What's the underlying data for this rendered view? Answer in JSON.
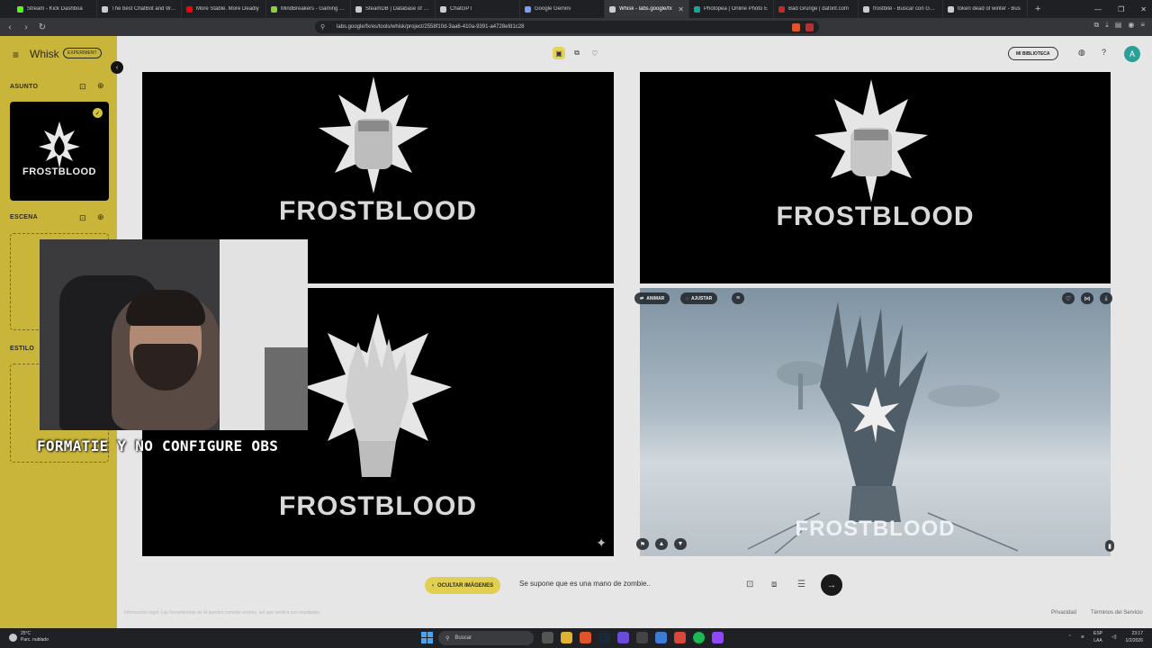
{
  "browser": {
    "tabs": [
      {
        "label": "Stream - Kick Dashboa",
        "color": "#53fc18",
        "active": false
      },
      {
        "label": "The best ChatBot and Widg",
        "color": "#cccccc",
        "active": false
      },
      {
        "label": "More Stable. More Deadly",
        "color": "#ff0000",
        "active": false
      },
      {
        "label": "MindBreakers - Gaming Co",
        "color": "#8ccf3a",
        "active": false
      },
      {
        "label": "SteamDB | Database of eve",
        "color": "#cccccc",
        "active": false
      },
      {
        "label": "ChatGPT",
        "color": "#cccccc",
        "active": false
      },
      {
        "label": "Google Gemini",
        "color": "#7b9cff",
        "active": false
      },
      {
        "label": "Whisk - labs.google/fx",
        "color": "#cccccc",
        "active": true
      },
      {
        "label": "Photopea | Online Photo E",
        "color": "#18a497",
        "active": false
      },
      {
        "label": "Bad Grunge | dafont.com",
        "color": "#c62828",
        "active": false
      },
      {
        "label": "frostbite - Buscar con Goog",
        "color": "#cccccc",
        "active": false
      },
      {
        "label": "token dead of winter - Bus",
        "color": "#cccccc",
        "active": false
      }
    ],
    "url": "labs.google/fx/es/tools/whisk/project/2558f10d-3aa6-410a-9391-a4728efd1c28"
  },
  "app": {
    "brand": "Whisk",
    "experiment_badge": "EXPERIMENT",
    "sections": {
      "subject": "ASUNTO",
      "scene": "ESCENA",
      "style": "ESTILO"
    },
    "subject_card_text": "FROSTBLOOD",
    "library_button": "MI BIBLIOTECA",
    "avatar_letter": "A",
    "images": [
      {
        "logo": "FROSTBLOOD"
      },
      {
        "logo": "FROSTBLOOD"
      },
      {
        "logo": "FROSTBLOOD"
      },
      {
        "logo": "FROSTBLOOD"
      }
    ],
    "image_actions": {
      "animate": "ANIMAR",
      "adjust": "AJUSTAR"
    },
    "hide_images_button": "OCULTAR IMÁGENES",
    "prompt_text": "Se supone que es una mano de zombie..",
    "footer_left": "Información legal: Las herramientas de IA pueden cometer errores, así que verifica sus resultados",
    "footer_privacy": "Privacidad",
    "footer_terms": "Términos del Servicio"
  },
  "stream_overlay": {
    "caption": "FORMATIE Y NO CONFIGURE OBS"
  },
  "taskbar": {
    "weather_temp": "25°C",
    "weather_desc": "Parc. nublado",
    "search_label": "Buscar",
    "lang_top": "ESP",
    "lang_bottom": "LAA",
    "time": "23:17",
    "date": "1/2/2026"
  }
}
